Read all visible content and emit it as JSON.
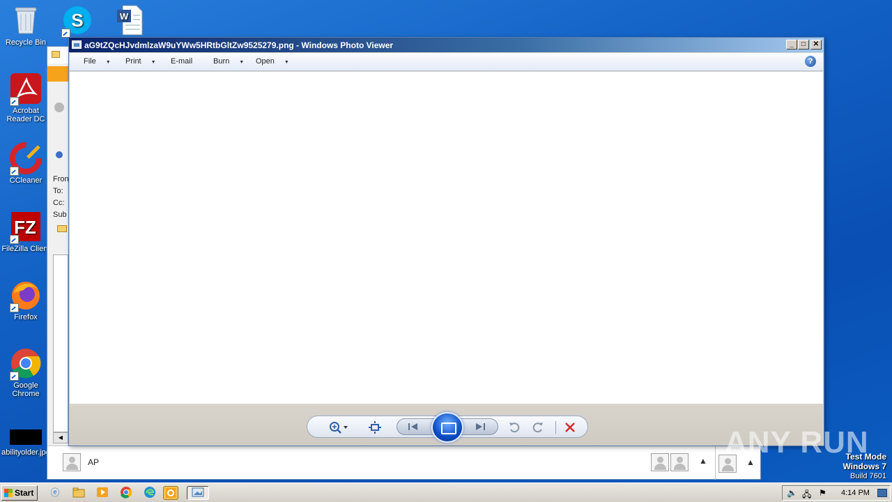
{
  "desktop_icons": [
    {
      "label": "Recycle Bin",
      "icon": "recycle-bin-icon"
    },
    {
      "label": "",
      "icon": "skype-icon"
    },
    {
      "label": "",
      "icon": "word-document-icon"
    },
    {
      "label": "Acrobat Reader DC",
      "icon": "acrobat-icon"
    },
    {
      "label": "CCleaner",
      "icon": "ccleaner-icon"
    },
    {
      "label": "FileZilla Client",
      "icon": "filezilla-icon"
    },
    {
      "label": "Firefox",
      "icon": "firefox-icon"
    },
    {
      "label": "Google Chrome",
      "icon": "chrome-icon"
    },
    {
      "label": "abilityolder.jpg",
      "icon": "image-file-icon"
    }
  ],
  "outlook": {
    "fields": [
      "Fron",
      "To:",
      "Cc:",
      "Sub"
    ],
    "recipient": "AP"
  },
  "viewer": {
    "title": "aG9tZQcHJvdmlzaW9uYWw5HRtbGltZw9525279.png - Windows Photo Viewer",
    "menu": [
      {
        "label": "File",
        "has_arrow": true
      },
      {
        "label": "Print",
        "has_arrow": true
      },
      {
        "label": "E-mail",
        "has_arrow": false
      },
      {
        "label": "Burn",
        "has_arrow": true
      },
      {
        "label": "Open",
        "has_arrow": true
      }
    ],
    "help": "?",
    "controls": {
      "zoom": "zoom-icon",
      "fit": "actual-size-icon",
      "previous": "previous-icon",
      "slideshow": "slideshow-icon",
      "next": "next-icon",
      "rotate_ccw": "rotate-ccw-icon",
      "rotate_cw": "rotate-cw-icon",
      "delete": "delete-icon"
    }
  },
  "taskbar": {
    "start": "Start",
    "clock": "4:14 PM"
  },
  "watermark": {
    "line1": "Test Mode",
    "line2": "Windows 7",
    "line3": "Build 7601",
    "brand": "ANY RUN"
  }
}
